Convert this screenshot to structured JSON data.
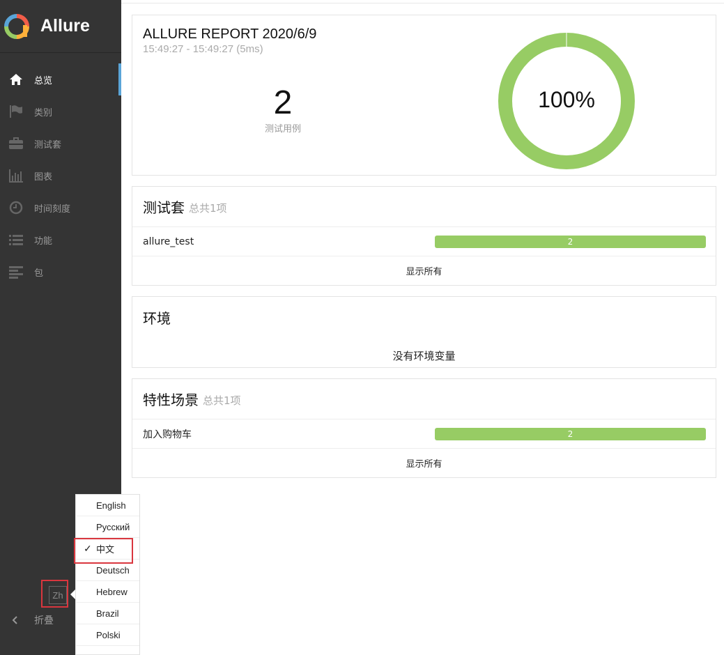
{
  "brand": {
    "name": "Allure"
  },
  "nav": [
    {
      "label": "总览",
      "icon": "home-icon",
      "active": true
    },
    {
      "label": "类别",
      "icon": "flag-icon"
    },
    {
      "label": "测试套",
      "icon": "briefcase-icon"
    },
    {
      "label": "图表",
      "icon": "bar-chart-icon"
    },
    {
      "label": "时间刻度",
      "icon": "clock-icon"
    },
    {
      "label": "功能",
      "icon": "list-icon"
    },
    {
      "label": "包",
      "icon": "align-left-icon"
    }
  ],
  "language_button": {
    "label": "Zh"
  },
  "collapse": {
    "label": "折叠"
  },
  "language_menu": {
    "items": [
      "English",
      "Русский",
      "中文",
      "Deutsch",
      "Hebrew",
      "Brazil",
      "Polski"
    ],
    "selected": "中文",
    "check": "✓"
  },
  "summary": {
    "title": "ALLURE REPORT 2020/6/9",
    "time": "15:49:27 - 15:49:27 (5ms)",
    "count": "2",
    "count_label": "测试用例",
    "percent_text": "100%",
    "passed_fraction": 1.0,
    "color": "#97cc64"
  },
  "suites": {
    "title": "测试套",
    "subtitle": "总共1项",
    "rows": [
      {
        "name": "allure_test",
        "value": "2"
      }
    ],
    "show_all": "显示所有"
  },
  "environment": {
    "title": "环境",
    "empty": "没有环境变量"
  },
  "features": {
    "title": "特性场景",
    "subtitle": "总共1项",
    "rows": [
      {
        "name": "加入购物车",
        "value": "2"
      }
    ],
    "show_all": "显示所有"
  }
}
